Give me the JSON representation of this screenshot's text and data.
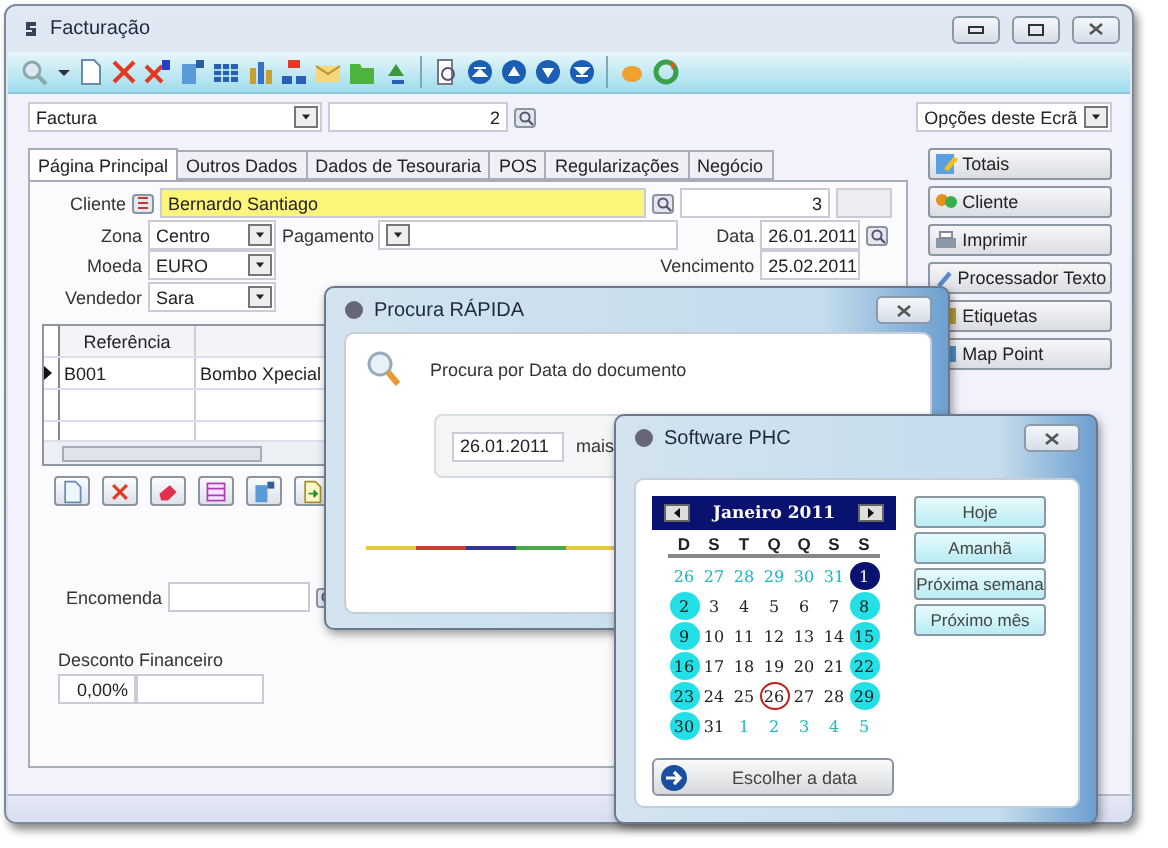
{
  "window": {
    "title": "Facturação"
  },
  "document_type": {
    "value": "Factura"
  },
  "document_number": {
    "value": "2"
  },
  "screen_options": {
    "value": "Opções deste Ecrã"
  },
  "side_buttons": [
    {
      "label": "Totais",
      "kind": "totals"
    },
    {
      "label": "Cliente",
      "kind": "client"
    },
    {
      "label": "Imprimir",
      "kind": "print"
    },
    {
      "label": "Processador Texto",
      "kind": "editor"
    },
    {
      "label": "Etiquetas",
      "kind": "labels"
    },
    {
      "label": "Map Point",
      "kind": "map"
    }
  ],
  "tabs": [
    {
      "label": "Página Principal",
      "selected": true
    },
    {
      "label": "Outros Dados",
      "selected": false
    },
    {
      "label": "Dados de Tesouraria",
      "selected": false
    },
    {
      "label": "POS",
      "selected": false
    },
    {
      "label": "Regularizações",
      "selected": false
    },
    {
      "label": "Negócio",
      "selected": false
    }
  ],
  "form": {
    "cliente": {
      "label": "Cliente",
      "value": "Bernardo Santiago",
      "number": "3"
    },
    "zona": {
      "label": "Zona",
      "value": "Centro"
    },
    "pagamento": {
      "label": "Pagamento"
    },
    "data": {
      "label": "Data",
      "value": "26.01.2011"
    },
    "moeda": {
      "label": "Moeda",
      "value": "EURO"
    },
    "vencimento": {
      "label": "Vencimento",
      "value": "25.02.2011"
    },
    "vendedor": {
      "label": "Vendedor",
      "value": "Sara"
    },
    "encomenda": {
      "label": "Encomenda"
    },
    "desconto": {
      "label": "Desconto Financeiro",
      "value": "0,00%"
    }
  },
  "grid": {
    "columns": [
      {
        "label": "Referência"
      }
    ],
    "rows": [
      {
        "current": true,
        "cells": [
          "B001",
          "Bombo Xpecial"
        ]
      }
    ]
  },
  "quick_search": {
    "title": "Procura RÁPIDA",
    "prompt": "Procura por Data do documento",
    "date": "26.01.2011",
    "more": "mais"
  },
  "date_picker": {
    "title": "Software PHC",
    "month": "Janeiro 2011",
    "weekdays": [
      "D",
      "S",
      "T",
      "Q",
      "Q",
      "S",
      "S"
    ],
    "weeks": [
      [
        {
          "day": "26",
          "kind": "other"
        },
        {
          "day": "27",
          "kind": "other"
        },
        {
          "day": "28",
          "kind": "other"
        },
        {
          "day": "29",
          "kind": "other"
        },
        {
          "day": "30",
          "kind": "other"
        },
        {
          "day": "31",
          "kind": "other"
        },
        {
          "day": "1",
          "kind": "selected"
        }
      ],
      [
        {
          "day": "2",
          "kind": "weekend"
        },
        {
          "day": "3",
          "kind": "plain"
        },
        {
          "day": "4",
          "kind": "plain"
        },
        {
          "day": "5",
          "kind": "plain"
        },
        {
          "day": "6",
          "kind": "plain"
        },
        {
          "day": "7",
          "kind": "plain"
        },
        {
          "day": "8",
          "kind": "weekend"
        }
      ],
      [
        {
          "day": "9",
          "kind": "weekend"
        },
        {
          "day": "10",
          "kind": "plain"
        },
        {
          "day": "11",
          "kind": "plain"
        },
        {
          "day": "12",
          "kind": "plain"
        },
        {
          "day": "13",
          "kind": "plain"
        },
        {
          "day": "14",
          "kind": "plain"
        },
        {
          "day": "15",
          "kind": "weekend"
        }
      ],
      [
        {
          "day": "16",
          "kind": "weekend"
        },
        {
          "day": "17",
          "kind": "plain"
        },
        {
          "day": "18",
          "kind": "plain"
        },
        {
          "day": "19",
          "kind": "plain"
        },
        {
          "day": "20",
          "kind": "plain"
        },
        {
          "day": "21",
          "kind": "plain"
        },
        {
          "day": "22",
          "kind": "weekend"
        }
      ],
      [
        {
          "day": "23",
          "kind": "weekend"
        },
        {
          "day": "24",
          "kind": "plain"
        },
        {
          "day": "25",
          "kind": "plain"
        },
        {
          "day": "26",
          "kind": "today"
        },
        {
          "day": "27",
          "kind": "plain"
        },
        {
          "day": "28",
          "kind": "plain"
        },
        {
          "day": "29",
          "kind": "weekend"
        }
      ],
      [
        {
          "day": "30",
          "kind": "weekend"
        },
        {
          "day": "31",
          "kind": "plain"
        },
        {
          "day": "1",
          "kind": "other"
        },
        {
          "day": "2",
          "kind": "other"
        },
        {
          "day": "3",
          "kind": "other"
        },
        {
          "day": "4",
          "kind": "other"
        },
        {
          "day": "5",
          "kind": "other"
        }
      ]
    ],
    "shortcuts": [
      "Hoje",
      "Amanhã",
      "Próxima semana",
      "Próximo mês"
    ],
    "choose": "Escolher a data"
  }
}
